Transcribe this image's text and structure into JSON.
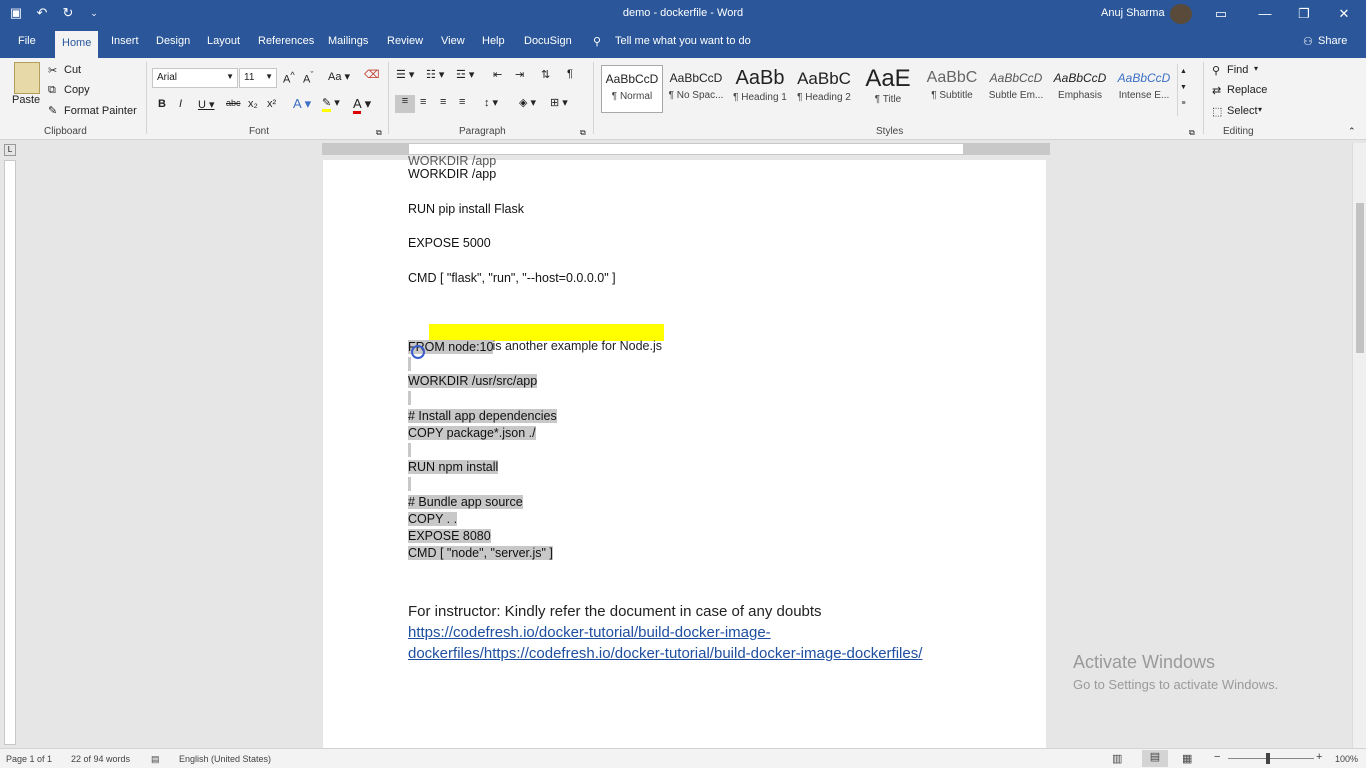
{
  "window": {
    "title": "demo - dockerfile - Word",
    "user": "Anuj Sharma"
  },
  "tabs": [
    "File",
    "Home",
    "Insert",
    "Design",
    "Layout",
    "References",
    "Mailings",
    "Review",
    "View",
    "Help",
    "DocuSign"
  ],
  "tell_me": "Tell me what you want to do",
  "share": "Share",
  "clipboard": {
    "paste": "Paste",
    "cut": "Cut",
    "copy": "Copy",
    "format_painter": "Format Painter",
    "label": "Clipboard"
  },
  "font": {
    "name": "Arial",
    "size": "11",
    "label": "Font"
  },
  "paragraph": {
    "label": "Paragraph"
  },
  "styles": {
    "label": "Styles",
    "items": [
      {
        "sample": "AaBbCcD",
        "name": "¶ Normal"
      },
      {
        "sample": "AaBbCcD",
        "name": "¶ No Spac..."
      },
      {
        "sample": "AaBb",
        "name": "¶ Heading 1"
      },
      {
        "sample": "AaBbC",
        "name": "¶ Heading 2"
      },
      {
        "sample": "AaE",
        "name": "¶ Title"
      },
      {
        "sample": "AaBbC",
        "name": "¶ Subtitle"
      },
      {
        "sample": "AaBbCcD",
        "name": "Subtle Em..."
      },
      {
        "sample": "AaBbCcD",
        "name": "Emphasis"
      },
      {
        "sample": "AaBbCcD",
        "name": "Intense E..."
      }
    ]
  },
  "editing": {
    "find": "Find",
    "replace": "Replace",
    "select": "Select",
    "label": "Editing"
  },
  "document": {
    "top_partial": "WORKDIR /app",
    "lines": {
      "workdir_app": "WORKDIR /app",
      "run_flask": "RUN pip install Flask",
      "expose_5000": "EXPOSE 5000",
      "cmd_flask": "CMD [ \"flask\", \"run\", \"--host=0.0.0.0\" ]",
      "bullet": "Here is another example for Node.js",
      "from_node": "FROM node:10",
      "workdir_src": "WORKDIR /usr/src/app",
      "comment_deps": "# Install app dependencies",
      "copy_pkg": "COPY package*.json ./",
      "run_npm": "RUN npm install",
      "comment_bundle": "# Bundle app source",
      "copy_all": "COPY . .",
      "expose_8080": "EXPOSE 8080",
      "cmd_node": "CMD [ \"node\", \"server.js\" ]"
    },
    "instructor_note": "For instructor: Kindly refer the document in case of any doubts",
    "link_line1": "https://codefresh.io/docker-tutorial/build-docker-image-",
    "link_line2": "dockerfiles/https://codefresh.io/docker-tutorial/build-docker-image-dockerfiles/"
  },
  "watermark": {
    "line1": "Activate Windows",
    "line2": "Go to Settings to activate Windows."
  },
  "status": {
    "page": "Page 1 of 1",
    "words": "22 of 94 words",
    "language": "English (United States)",
    "zoom": "100%"
  }
}
